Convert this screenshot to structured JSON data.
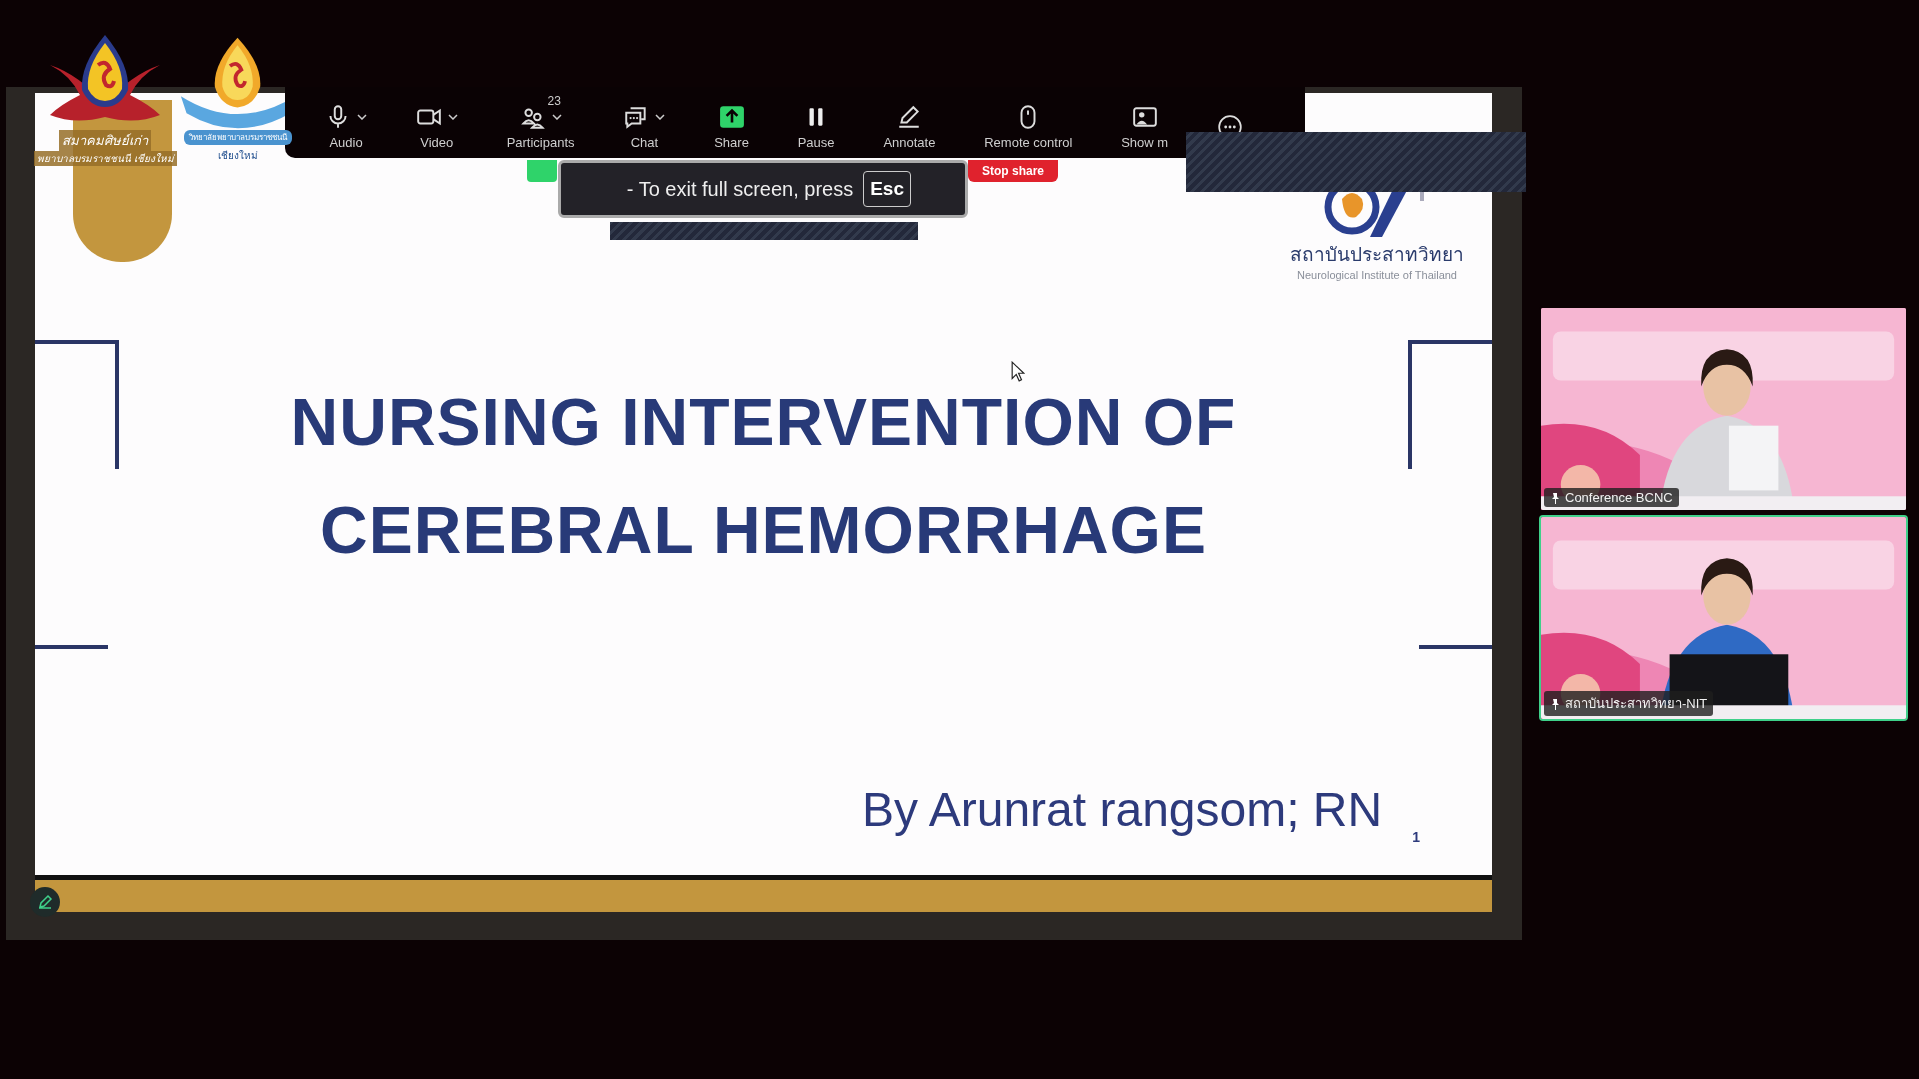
{
  "event_logos": [
    {
      "kind": "association",
      "lines": [
        "สมาคมศิษย์เก่า",
        "พยาบาลบรมราชชนนี เชียงใหม่"
      ]
    },
    {
      "kind": "college",
      "lines": [
        "วิทยาลัยพยาบาลบรมราชชนนี",
        "เชียงใหม่"
      ]
    }
  ],
  "toolbar": {
    "items": [
      {
        "kind": "mic",
        "label": "Audio",
        "caret": true
      },
      {
        "kind": "camera",
        "label": "Video",
        "caret": true
      },
      {
        "kind": "participants",
        "label": "Participants",
        "count": "23",
        "caret": true
      },
      {
        "kind": "chat",
        "label": "Chat",
        "caret": true
      },
      {
        "kind": "share",
        "label": "Share",
        "caret": false
      },
      {
        "kind": "pause",
        "label": "Pause",
        "caret": false
      },
      {
        "kind": "annotate",
        "label": "Annotate",
        "caret": false
      },
      {
        "kind": "remote",
        "label": "Remote control",
        "caret": false
      },
      {
        "kind": "show",
        "label": "Show m",
        "caret": false
      },
      {
        "kind": "more",
        "caret": false
      }
    ]
  },
  "share_banner": {
    "stop_label": "Stop share"
  },
  "toast": {
    "text": "- To exit full screen, press",
    "key": "Esc"
  },
  "slide": {
    "institute": {
      "name": "สถาบันประสาทวิทยา",
      "subtitle": "Neurological Institute of Thailand"
    },
    "title_lines": [
      "NURSING INTERVENTION OF",
      "CEREBRAL HEMORRHAGE"
    ],
    "author": "By Arunrat rangsom; RN",
    "page_number": "1"
  },
  "videos": [
    {
      "name": "Conference BCNC",
      "active_speaker": false
    },
    {
      "name": "สถาบันประสาทวิทยา-NIT",
      "active_speaker": true
    }
  ]
}
